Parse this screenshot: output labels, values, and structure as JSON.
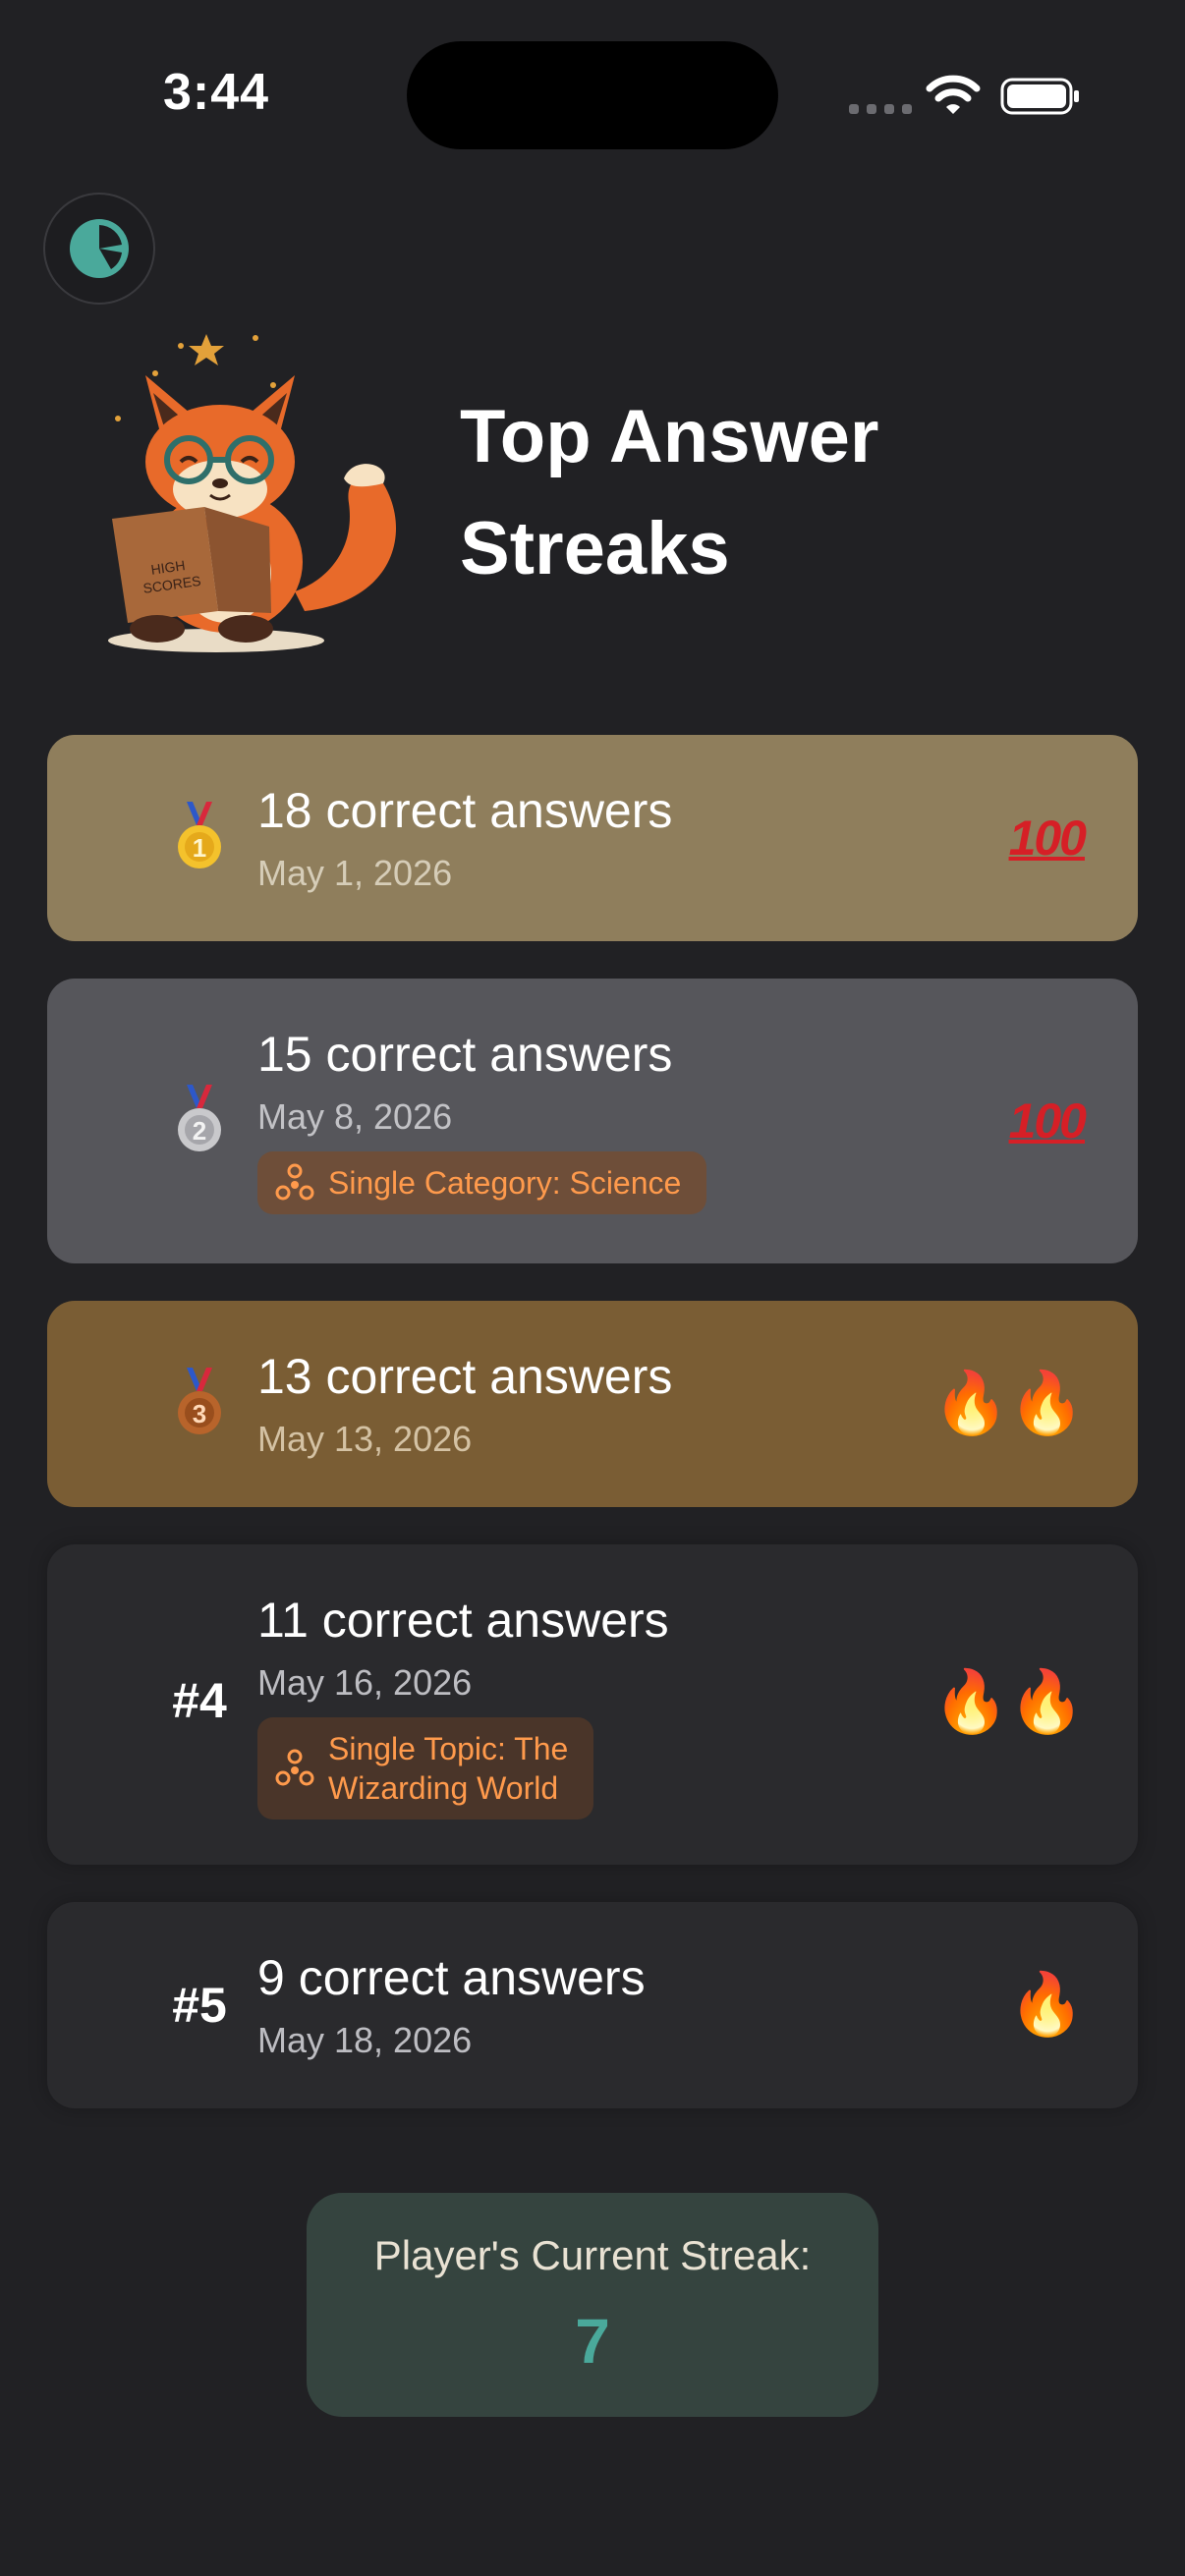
{
  "status_bar": {
    "time": "3:44"
  },
  "header": {
    "title": "Top Answer Streaks",
    "mascot_book_text_1": "HIGH",
    "mascot_book_text_2": "SCORES"
  },
  "streaks": [
    {
      "rank": "1",
      "rank_style": "gold-medal",
      "title": "18 correct answers",
      "date": "May 1, 2026",
      "mode": "",
      "badge": "100",
      "flames": 0
    },
    {
      "rank": "2",
      "rank_style": "silver-medal",
      "title": "15 correct answers",
      "date": "May 8, 2026",
      "mode": "Single Category: Science",
      "badge": "100",
      "flames": 0
    },
    {
      "rank": "3",
      "rank_style": "bronze-medal",
      "title": "13 correct answers",
      "date": "May 13, 2026",
      "mode": "",
      "badge": "🔥🔥",
      "flames": 2
    },
    {
      "rank": "#4",
      "rank_style": "text",
      "title": "11 correct answers",
      "date": "May 16, 2026",
      "mode_line_1": "Single Topic: The",
      "mode_line_2": "Wizarding World",
      "badge": "🔥🔥",
      "flames": 2
    },
    {
      "rank": "#5",
      "rank_style": "text",
      "title": "9 correct answers",
      "date": "May 18, 2026",
      "mode": "",
      "badge": "🔥",
      "flames": 1
    }
  ],
  "current_streak": {
    "label": "Player's Current Streak:",
    "value": "7"
  },
  "colors": {
    "background": "#212124",
    "gold_card": "#8f7e5c",
    "silver_card": "#56565b",
    "bronze_card": "#7a5d34",
    "plain_card": "#2a2a2d",
    "accent_teal": "#4aa99b",
    "tag_text": "#ff9a4c"
  }
}
